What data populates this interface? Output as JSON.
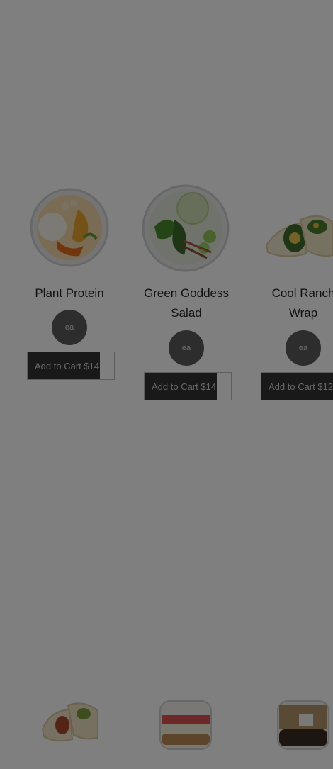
{
  "products": [
    {
      "title": "Plant Protein",
      "title_line2": "",
      "unit": "ea",
      "cart_label": "Add to Cart $14"
    },
    {
      "title": "Green Goddess",
      "title_line2": "Salad",
      "unit": "ea",
      "cart_label": "Add to Cart $14"
    },
    {
      "title": "Cool Ranch",
      "title_line2": "Wrap",
      "unit": "ea",
      "cart_label": "Add to Cart $12"
    }
  ],
  "overlay_color": "#000000",
  "button_color": "#333333"
}
